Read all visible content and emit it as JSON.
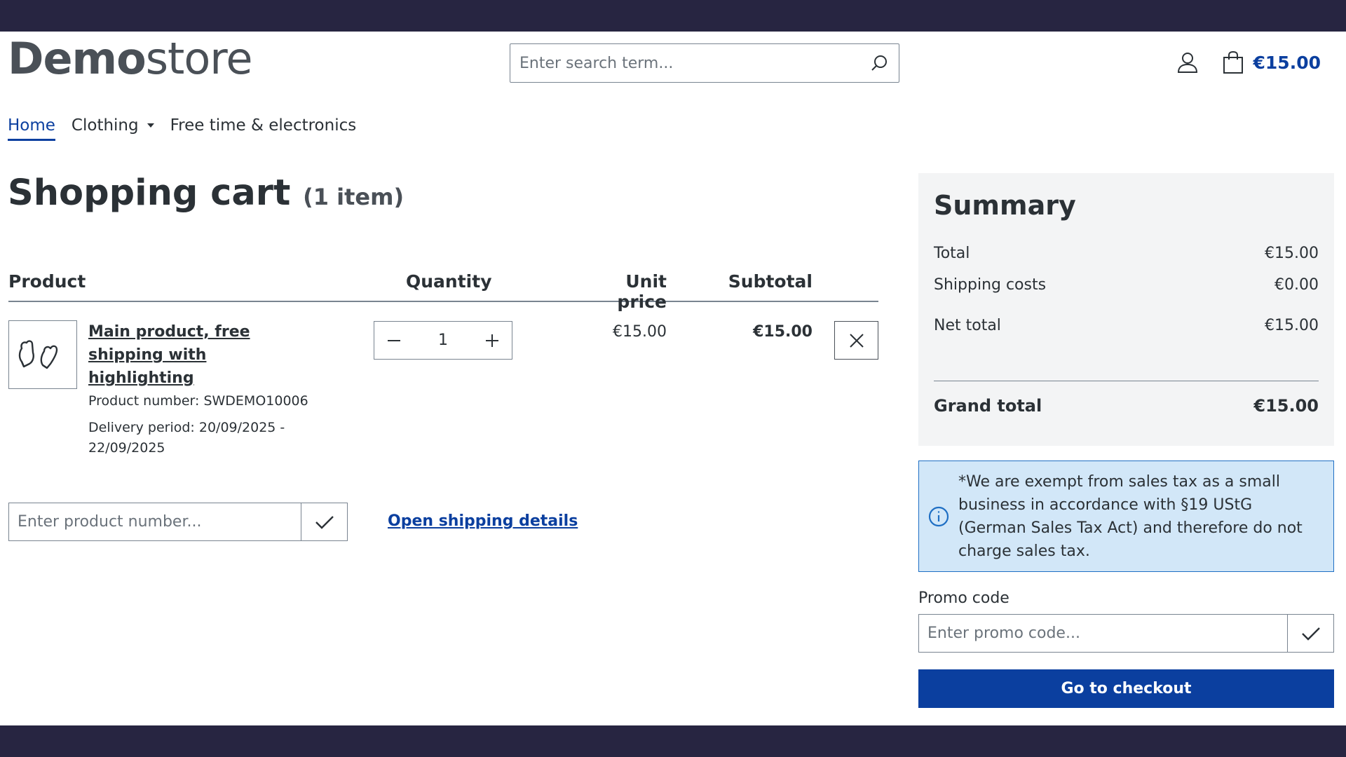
{
  "header": {
    "logo_bold": "Demo",
    "logo_light": "store",
    "search_placeholder": "Enter search term...",
    "cart_total": "€15.00"
  },
  "nav": {
    "items": [
      {
        "label": "Home",
        "active": true
      },
      {
        "label": "Clothing",
        "has_dropdown": true
      },
      {
        "label": "Free time & electronics"
      }
    ]
  },
  "cart": {
    "title": "Shopping cart",
    "count_label": "(1 item)",
    "columns": [
      "Product",
      "Quantity",
      "Unit price",
      "Subtotal"
    ],
    "items": [
      {
        "name": "Main product, free shipping with highlighting",
        "product_number": "Product number: SWDEMO10006",
        "delivery": "Delivery period: 20/09/2025 - 22/09/2025",
        "quantity": "1",
        "unit_price": "€15.00",
        "subtotal": "€15.00"
      }
    ],
    "product_number_placeholder": "Enter product number...",
    "shipping_link": "Open shipping details"
  },
  "summary": {
    "title": "Summary",
    "rows": [
      {
        "label": "Total",
        "value": "€15.00"
      },
      {
        "label": "Shipping costs",
        "value": "€0.00"
      },
      {
        "label": "Net total",
        "value": "€15.00"
      }
    ],
    "grand_total_label": "Grand total",
    "grand_total_value": "€15.00"
  },
  "tax_notice": "*We are exempt from sales tax as a small business in accordance with §19 UStG (German Sales Tax Act) and therefore do not charge sales tax.",
  "promo": {
    "label": "Promo code",
    "placeholder": "Enter promo code..."
  },
  "checkout_label": "Go to checkout",
  "colors": {
    "brand_blue": "#0b3f9f",
    "frame": "#272541",
    "info_bg": "#d2e7f8"
  }
}
